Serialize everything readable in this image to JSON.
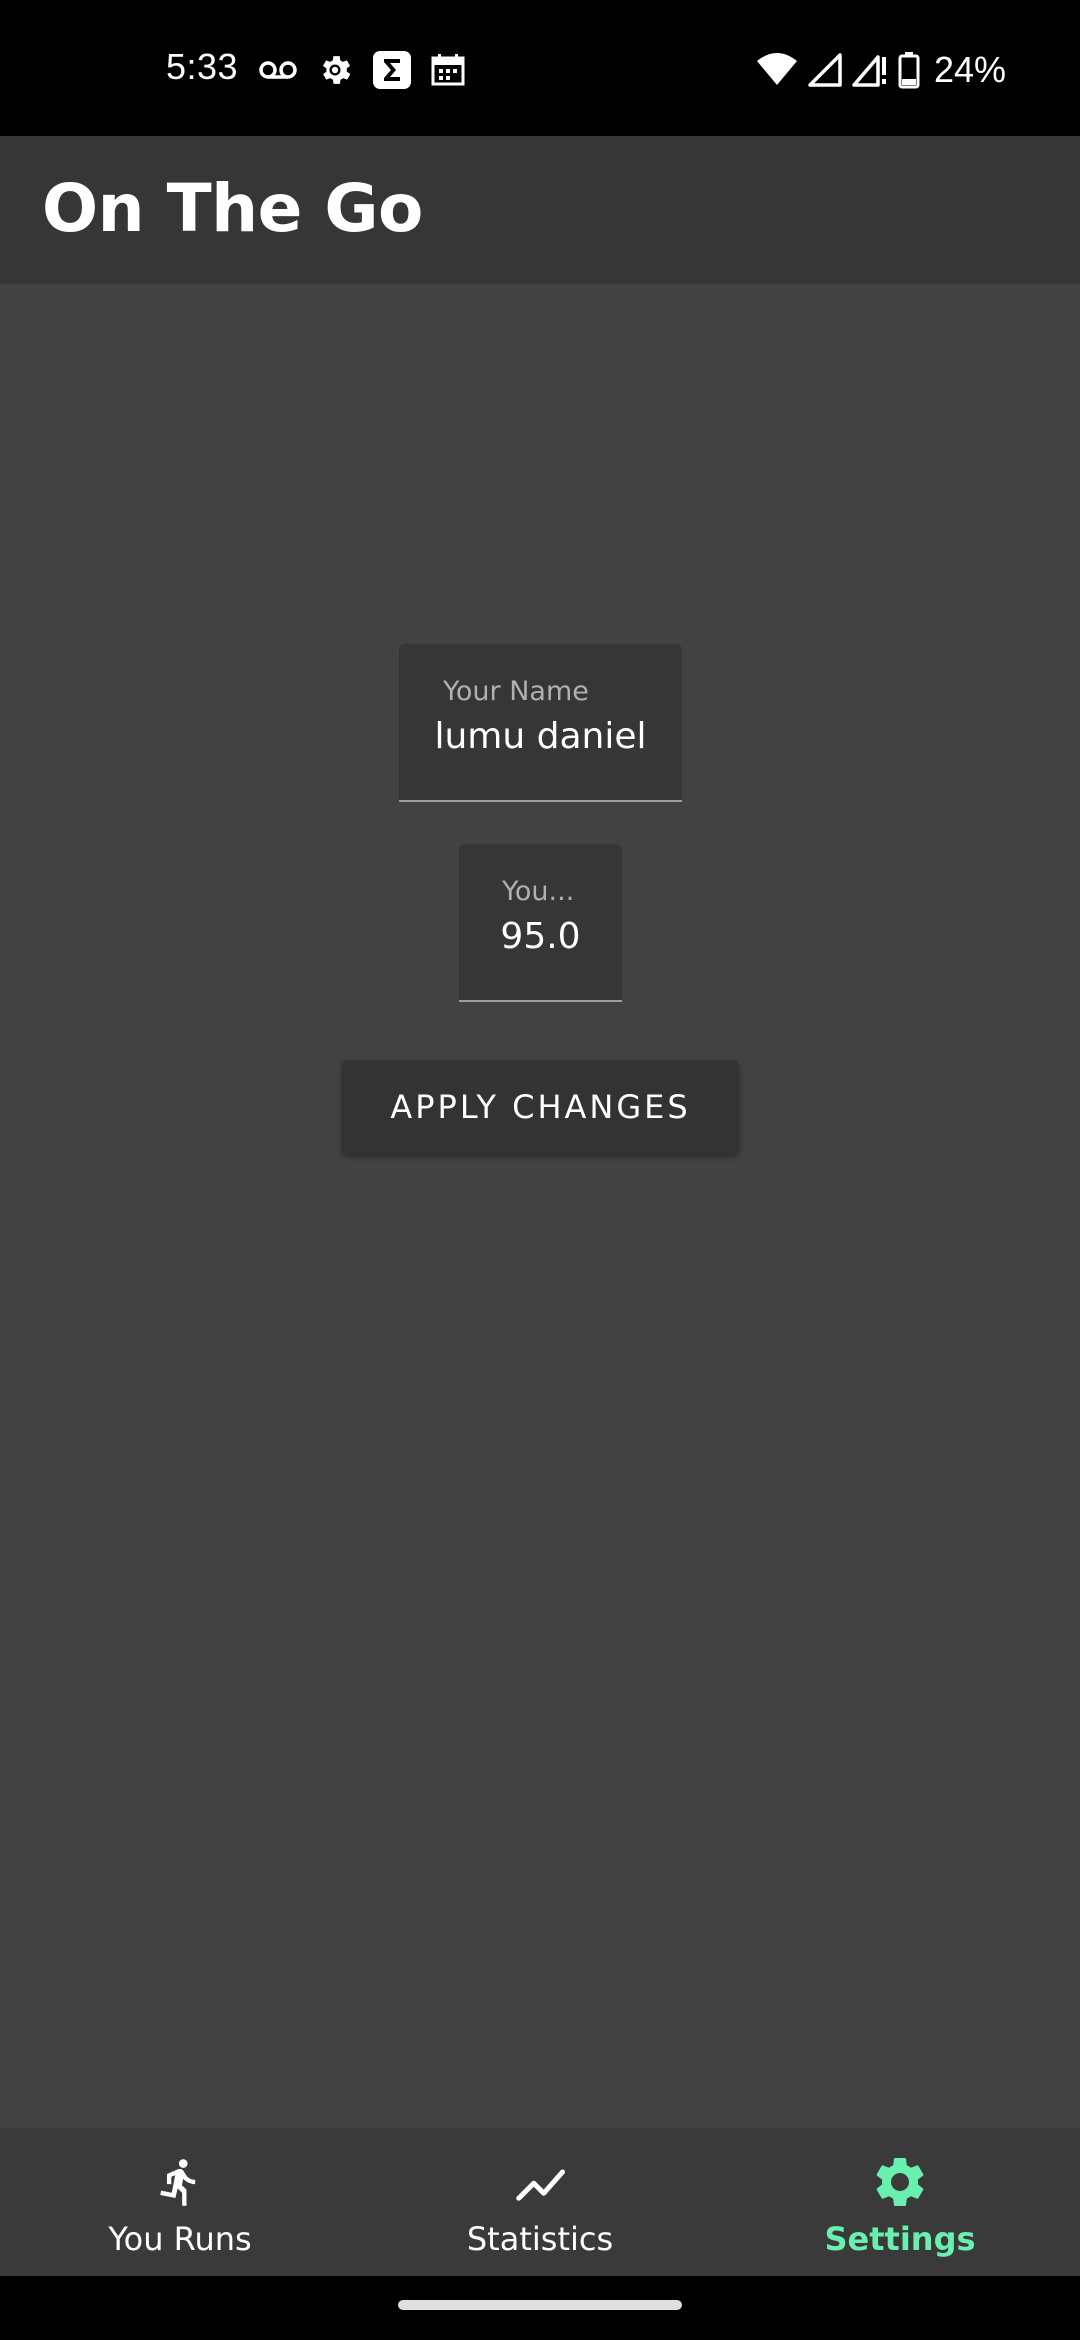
{
  "status_bar": {
    "time": "5:33",
    "battery": "24%",
    "left_icons": [
      "voicemail-icon",
      "settings-gear-icon",
      "sigma-app-icon",
      "calendar-icon"
    ],
    "right_icons": [
      "wifi-icon",
      "signal-icon",
      "signal-no-data-icon",
      "battery-icon"
    ]
  },
  "app_bar": {
    "title": "On The Go"
  },
  "form": {
    "name_field": {
      "label": "Your Name",
      "value": "lumu daniel"
    },
    "weight_field": {
      "label": "You...",
      "value": "95.0"
    },
    "apply_button": "APPLY CHANGES"
  },
  "bottom_nav": {
    "items": [
      {
        "label": "You Runs",
        "icon": "running-person-icon",
        "active": false
      },
      {
        "label": "Statistics",
        "icon": "trending-line-icon",
        "active": false
      },
      {
        "label": "Settings",
        "icon": "gear-icon",
        "active": true
      }
    ]
  },
  "colors": {
    "background": "#424242",
    "app_bar": "#363636",
    "active_nav": "#69f0ae"
  }
}
